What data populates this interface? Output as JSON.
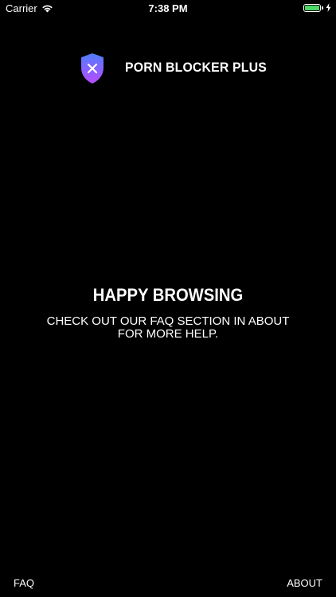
{
  "status_bar": {
    "carrier": "Carrier",
    "time": "7:38 PM",
    "battery_level": 1.0,
    "battery_color": "#4cd964"
  },
  "header": {
    "logo_icon": "shield-x-icon",
    "title": "PORN BLOCKER PLUS",
    "logo_colors": [
      "#4f7dff",
      "#b94bff"
    ]
  },
  "main": {
    "headline": "HAPPY BROWSING",
    "message": "CHECK OUT OUR FAQ SECTION IN ABOUT FOR MORE HELP."
  },
  "footer": {
    "faq_label": "FAQ",
    "about_label": "ABOUT"
  }
}
